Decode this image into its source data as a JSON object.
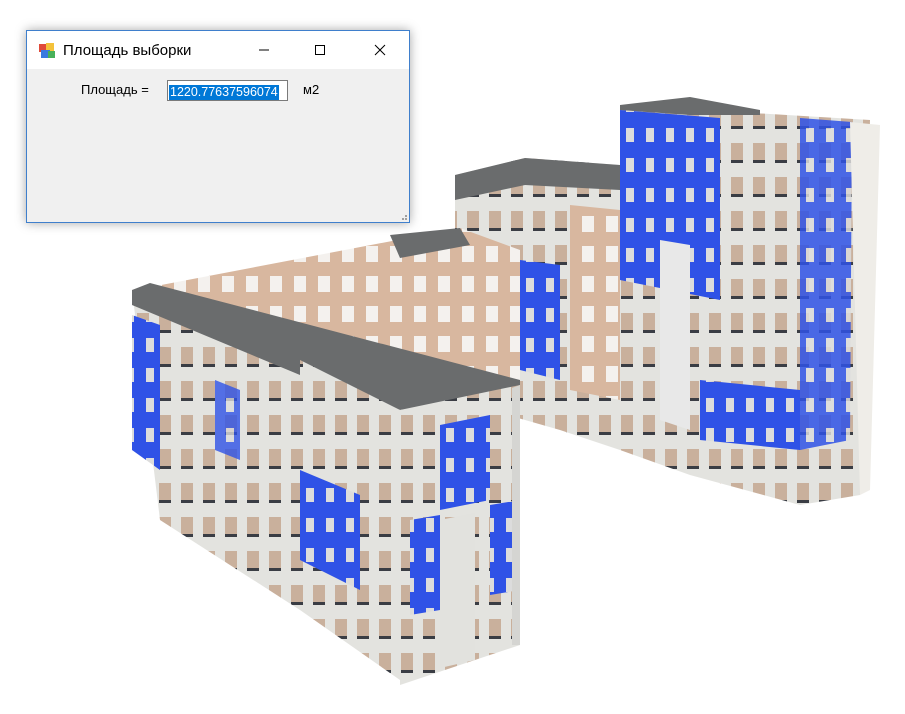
{
  "window": {
    "title": "Площадь выборки",
    "icon": "app-icon",
    "controls": [
      "minimize-icon",
      "maximize-icon",
      "close-icon"
    ]
  },
  "form": {
    "area_label": "Площадь =",
    "area_value": "1220.77637596074",
    "unit": "м2"
  },
  "scene": {
    "description_icon": "3d-building-model",
    "colors": {
      "slab_top": "#686b6c",
      "facade_light": "#e5e5e3",
      "interior_tan": "#d9b8a2",
      "selected_blue": "#2f52e6",
      "window_dark": "#3a3d44"
    }
  }
}
